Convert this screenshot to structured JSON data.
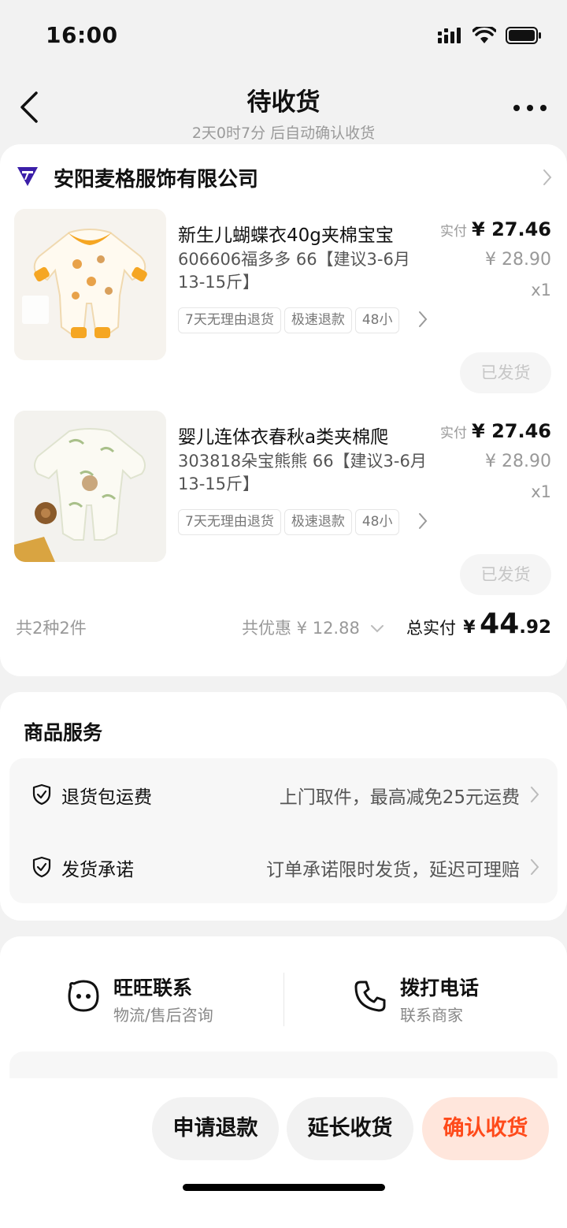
{
  "status_bar": {
    "time": "16:00"
  },
  "nav": {
    "title": "待收货",
    "subtitle": "2天0时7分 后自动确认收货"
  },
  "shop": {
    "name": "安阳麦格服饰有限公司"
  },
  "items": [
    {
      "title": "新生儿蝴蝶衣40g夹棉宝宝",
      "sku": "606606福多多 66【建议3-6月13-15斤】",
      "tags": [
        "7天无理由退货",
        "极速退款",
        "48小"
      ],
      "paid_label": "实付",
      "paid_price": "¥ 27.46",
      "orig_price": "¥ 28.90",
      "qty": "x1",
      "status_button": "已发货"
    },
    {
      "title": "婴儿连体衣春秋a类夹棉爬",
      "sku": "303818朵宝熊熊 66【建议3-6月13-15斤】",
      "tags": [
        "7天无理由退货",
        "极速退款",
        "48小"
      ],
      "paid_label": "实付",
      "paid_price": "¥ 27.46",
      "orig_price": "¥ 28.90",
      "qty": "x1",
      "status_button": "已发货"
    }
  ],
  "summary": {
    "count": "共2种2件",
    "discount": "共优惠 ¥ 12.88",
    "total_label": "总实付",
    "total_currency": "¥",
    "total_int": "44",
    "total_dec": ".92"
  },
  "services": {
    "title": "商品服务",
    "rows": [
      {
        "name": "退货包运费",
        "desc": "上门取件，最高减免25元运费"
      },
      {
        "name": "发货承诺",
        "desc": "订单承诺限时发货，延迟可理赔"
      }
    ]
  },
  "contacts": [
    {
      "title": "旺旺联系",
      "sub": "物流/售后咨询",
      "icon": "chat-face-icon"
    },
    {
      "title": "拨打电话",
      "sub": "联系商家",
      "icon": "phone-icon"
    }
  ],
  "actions": {
    "refund": "申请退款",
    "extend": "延长收货",
    "confirm": "确认收货"
  },
  "colors": {
    "accent": "#ff4a1a",
    "accent_bg": "#ffe6dc",
    "shop_logo": "#3b1fa8"
  }
}
